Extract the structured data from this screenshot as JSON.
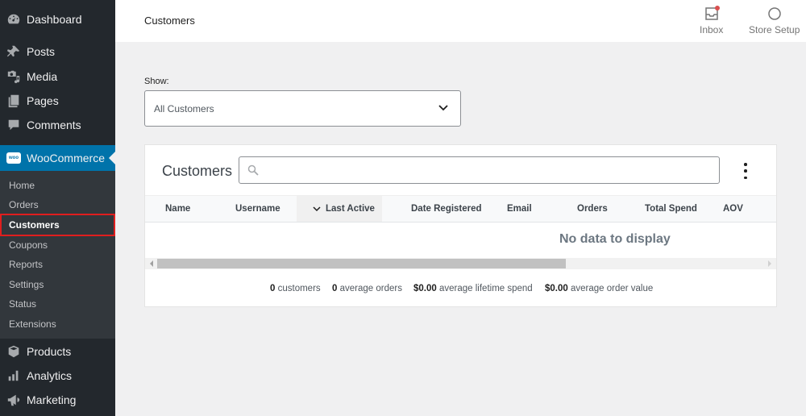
{
  "sidebar": {
    "top_items": [
      {
        "label": "Dashboard",
        "icon": "dashboard-icon"
      },
      {
        "label": "Posts",
        "icon": "pushpin-icon"
      },
      {
        "label": "Media",
        "icon": "media-icon"
      },
      {
        "label": "Pages",
        "icon": "pages-icon"
      },
      {
        "label": "Comments",
        "icon": "comment-icon"
      }
    ],
    "woocommerce": {
      "label": "WooCommerce",
      "icon_text": "woo"
    },
    "submenu": [
      {
        "label": "Home"
      },
      {
        "label": "Orders"
      },
      {
        "label": "Customers",
        "active": true
      },
      {
        "label": "Coupons"
      },
      {
        "label": "Reports"
      },
      {
        "label": "Settings"
      },
      {
        "label": "Status"
      },
      {
        "label": "Extensions"
      }
    ],
    "bottom_items": [
      {
        "label": "Products",
        "icon": "box-icon"
      },
      {
        "label": "Analytics",
        "icon": "bar-chart-icon"
      },
      {
        "label": "Marketing",
        "icon": "megaphone-icon"
      }
    ]
  },
  "header": {
    "title": "Customers",
    "inbox_label": "Inbox",
    "store_setup_label": "Store Setup",
    "inbox_has_notification": true
  },
  "filter": {
    "label": "Show:",
    "selected": "All Customers"
  },
  "table": {
    "title": "Customers",
    "search_placeholder": "",
    "columns": [
      {
        "label": "Name"
      },
      {
        "label": "Username"
      },
      {
        "label": "Last Active",
        "sorted": "desc"
      },
      {
        "label": "Date Registered"
      },
      {
        "label": "Email"
      },
      {
        "label": "Orders"
      },
      {
        "label": "Total Spend"
      },
      {
        "label": "AOV"
      }
    ],
    "empty_message": "No data to display",
    "scroll_position": 0
  },
  "summary": [
    {
      "value": "0",
      "label": "customers"
    },
    {
      "value": "0",
      "label": "average orders"
    },
    {
      "value": "$0.00",
      "label": "average lifetime spend"
    },
    {
      "value": "$0.00",
      "label": "average order value"
    }
  ],
  "colors": {
    "sidebar_bg": "#23282d",
    "submenu_bg": "#32373c",
    "accent": "#0073aa",
    "highlight_border": "#e01e1e",
    "notification_dot": "#d94f4f"
  }
}
